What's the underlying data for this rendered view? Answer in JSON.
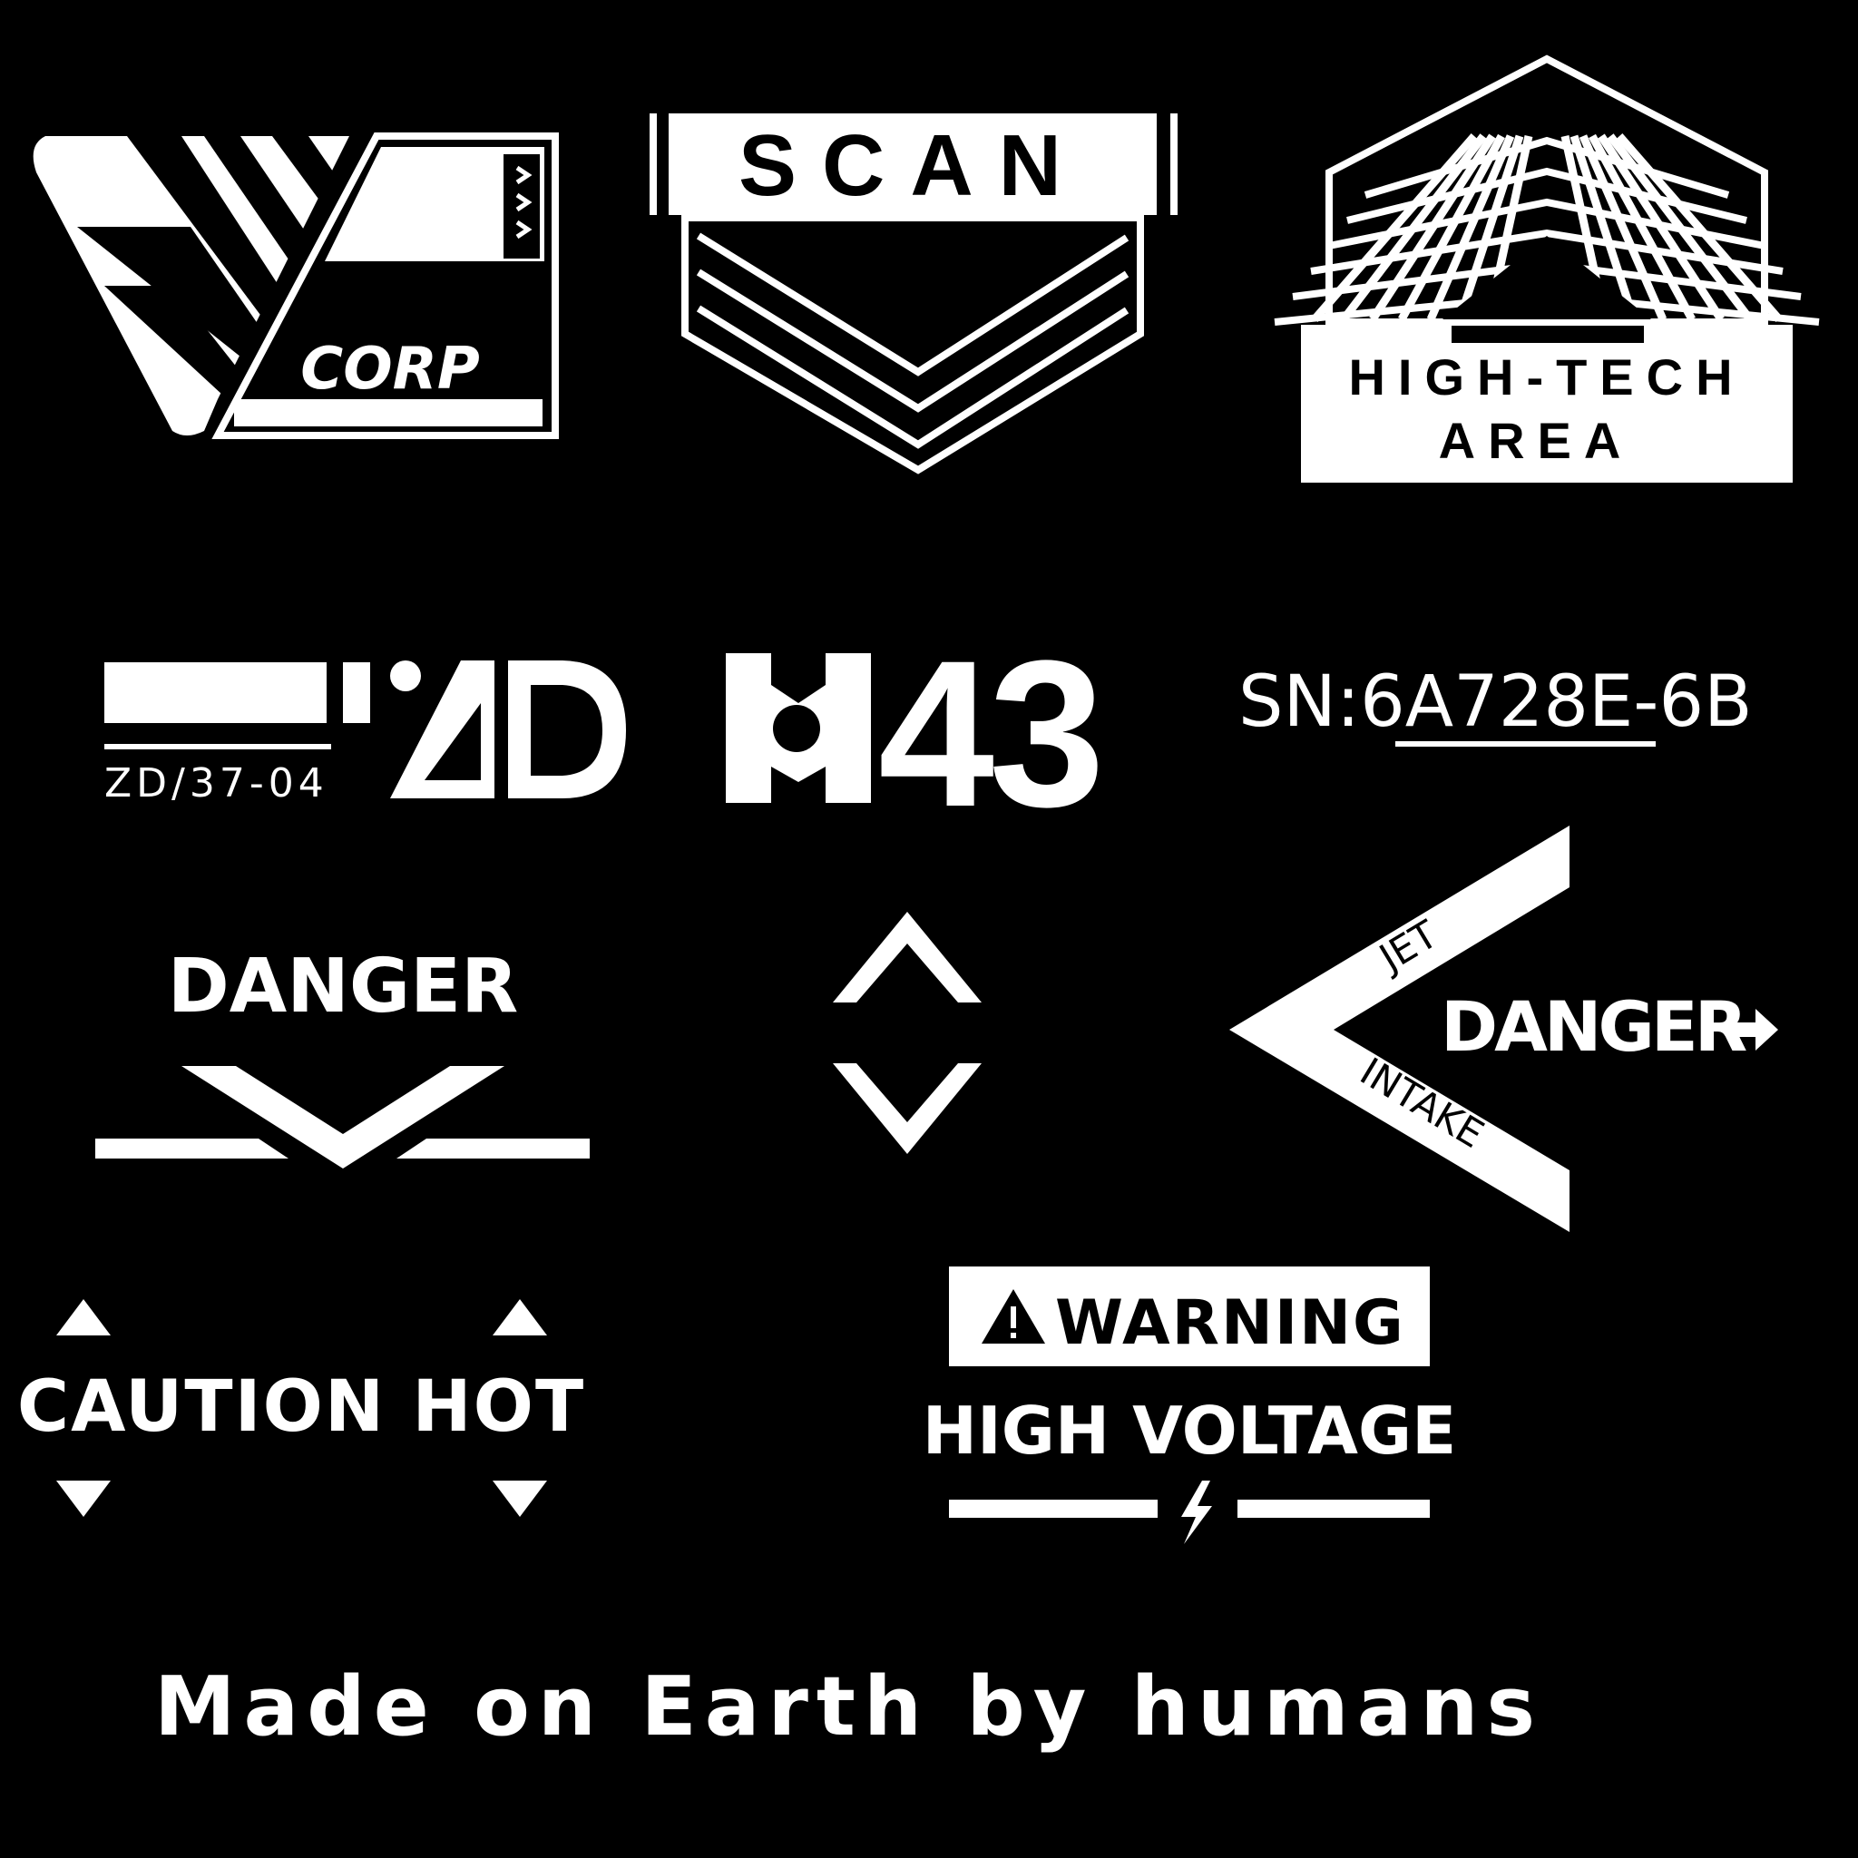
{
  "colors": {
    "background": "#000000",
    "foreground": "#ffffff"
  },
  "corp_badge": {
    "label": "CORP"
  },
  "scan_badge": {
    "label": "SCAN"
  },
  "hightech_badge": {
    "line1": "HIGH-TECH",
    "line2": "AREA"
  },
  "zd_tag": {
    "code": "ZD/37-04",
    "mark": "AD"
  },
  "m43": {
    "label": "43"
  },
  "serial": {
    "prefix": "SN:",
    "underlined": "6A728E",
    "suffix": "-6B"
  },
  "danger_chevron": {
    "label": "DANGER"
  },
  "jet_intake": {
    "word1": "JET",
    "word2": "INTAKE",
    "danger": "DANGER"
  },
  "caution": {
    "label": "CAUTION HOT"
  },
  "warning": {
    "title": "WARNING",
    "subtitle": "HIGH VOLTAGE",
    "icon": "warning-triangle-icon"
  },
  "footer": {
    "tagline": "Made on Earth by humans"
  }
}
